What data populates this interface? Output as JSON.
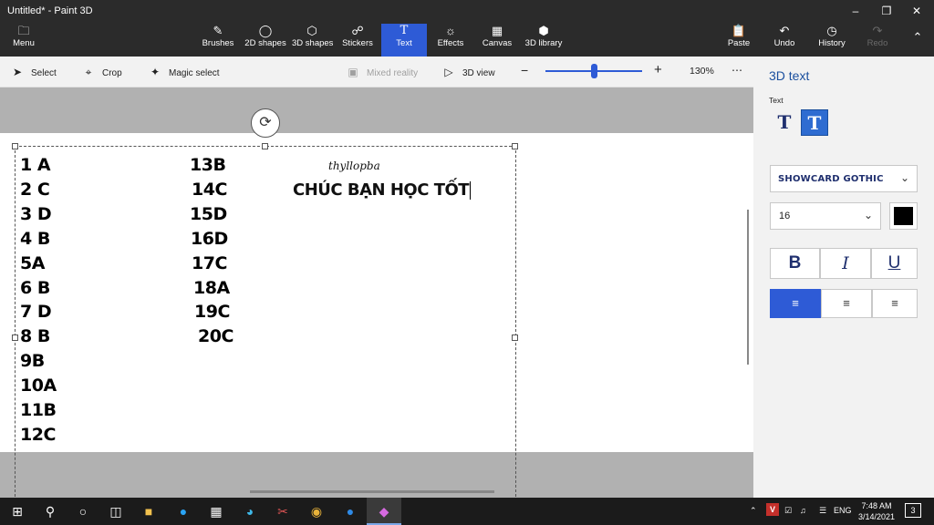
{
  "window": {
    "title": "Untitled* - Paint 3D"
  },
  "ribbon": {
    "menu": "Menu",
    "tools": [
      {
        "label": "Brushes",
        "icon": "brush-icon"
      },
      {
        "label": "2D shapes",
        "icon": "2d-shapes-icon"
      },
      {
        "label": "3D shapes",
        "icon": "3d-shapes-icon"
      },
      {
        "label": "Stickers",
        "icon": "stickers-icon"
      },
      {
        "label": "Text",
        "icon": "text-icon",
        "active": true
      },
      {
        "label": "Effects",
        "icon": "effects-icon"
      },
      {
        "label": "Canvas",
        "icon": "canvas-icon"
      },
      {
        "label": "3D library",
        "icon": "3d-library-icon"
      }
    ],
    "paste": "Paste",
    "undo": "Undo",
    "history": "History",
    "redo": "Redo"
  },
  "toolbar": {
    "select": "Select",
    "crop": "Crop",
    "magic_select": "Magic select",
    "mixed_reality": "Mixed reality",
    "view_3d": "3D view",
    "zoom": "130%",
    "zoom_fraction": 0.5
  },
  "canvas": {
    "col1": [
      "1 A",
      "2 C",
      "3 D",
      "4 B",
      "5A",
      "6 B",
      "7 D",
      "8 B",
      "9B",
      "10A",
      "11B",
      "12C"
    ],
    "col2": [
      "13B",
      "14C",
      "15D",
      "16D",
      "17C",
      "18A",
      "19C",
      "20C"
    ],
    "signature": "thyllopba",
    "wish": "CHÚC BẠN HỌC TỐT"
  },
  "panel": {
    "title": "3D text",
    "text_label": "Text",
    "font": "SHOWCARD GOTHIC",
    "size": "16",
    "color": "#000000",
    "bold": "B",
    "italic": "I",
    "underline": "U",
    "alignment": "left"
  },
  "taskbar": {
    "language": "ENG",
    "time": "7:48 AM",
    "date": "3/14/2021",
    "notification_count": "3"
  },
  "colors": {
    "accent": "#2e5bd6",
    "ribbon": "#2b2b2b",
    "taskbar": "#1b1b1b"
  }
}
